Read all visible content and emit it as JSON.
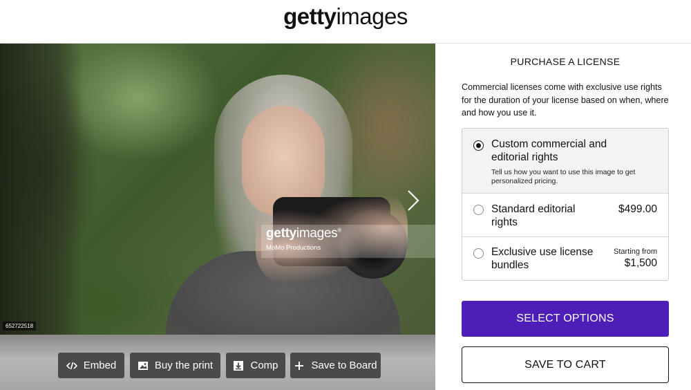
{
  "header": {
    "logo_bold": "getty",
    "logo_regular": "images"
  },
  "image": {
    "watermark_logo_bold": "getty",
    "watermark_logo_regular": "images",
    "watermark_reg": "®",
    "credit": "MoMo Productions",
    "id": "652722518"
  },
  "actions": [
    {
      "label": "Embed",
      "icon": "code-icon"
    },
    {
      "label": "Buy the print",
      "icon": "image-icon"
    },
    {
      "label": "Comp",
      "icon": "download-icon"
    },
    {
      "label": "Save to Board",
      "icon": "plus-icon"
    }
  ],
  "license": {
    "title": "PURCHASE A LICENSE",
    "description": "Commercial licenses come with exclusive use rights for the duration of your license based on when, where and how you use it.",
    "options": [
      {
        "label": "Custom commercial and editorial rights",
        "sub": "Tell us how you want to use this image to get personalized pricing.",
        "selected": true
      },
      {
        "label": "Standard editorial rights",
        "price": "$499.00",
        "selected": false
      },
      {
        "label": "Exclusive use license bundles",
        "price_note": "Starting from",
        "price": "$1,500",
        "selected": false
      }
    ],
    "select_label": "SELECT OPTIONS",
    "cart_label": "SAVE TO CART"
  },
  "colors": {
    "select_button": "#4d1fb8",
    "action_button": "#4a4a48"
  }
}
